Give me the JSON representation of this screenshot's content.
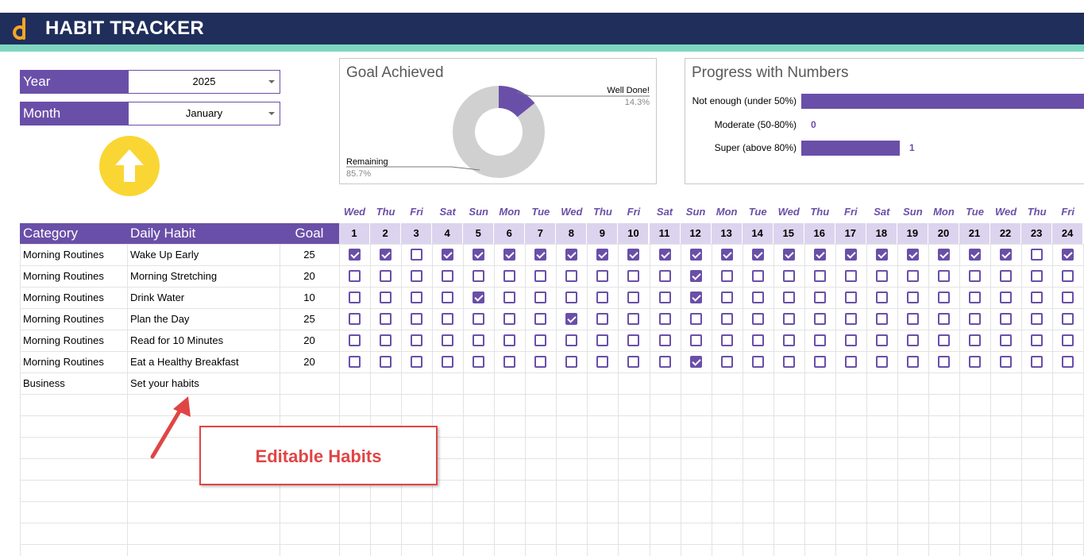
{
  "app": {
    "title": "HABIT TRACKER"
  },
  "selectors": {
    "year": {
      "label": "Year",
      "value": "2025"
    },
    "month": {
      "label": "Month",
      "value": "January"
    }
  },
  "goal_chart": {
    "title": "Goal Achieved",
    "slices": [
      {
        "name": "Well Done!",
        "percent_label": "14.3%",
        "value": 14.3,
        "color": "#6a4fa8"
      },
      {
        "name": "Remaining",
        "percent_label": "85.7%",
        "value": 85.7,
        "color": "#d0d0d0"
      }
    ]
  },
  "progress_chart": {
    "title": "Progress with Numbers",
    "rows": [
      {
        "label": "Not enough (under 50%)",
        "value": 5,
        "value_label": ""
      },
      {
        "label": "Moderate (50-80%)",
        "value": 0,
        "value_label": "0"
      },
      {
        "label": "Super (above 80%)",
        "value": 1,
        "value_label": "1"
      }
    ],
    "bar_color": "#6a4fa8"
  },
  "chart_data": [
    {
      "type": "pie",
      "title": "Goal Achieved",
      "categories": [
        "Well Done!",
        "Remaining"
      ],
      "values": [
        14.3,
        85.7
      ]
    },
    {
      "type": "bar",
      "title": "Progress with Numbers",
      "categories": [
        "Not enough (under 50%)",
        "Moderate (50-80%)",
        "Super (above 80%)"
      ],
      "values": [
        5,
        0,
        1
      ]
    }
  ],
  "table": {
    "headers": {
      "category": "Category",
      "habit": "Daily Habit",
      "goal": "Goal"
    },
    "days": [
      {
        "n": "1",
        "d": "Wed"
      },
      {
        "n": "2",
        "d": "Thu"
      },
      {
        "n": "3",
        "d": "Fri"
      },
      {
        "n": "4",
        "d": "Sat"
      },
      {
        "n": "5",
        "d": "Sun"
      },
      {
        "n": "6",
        "d": "Mon"
      },
      {
        "n": "7",
        "d": "Tue"
      },
      {
        "n": "8",
        "d": "Wed"
      },
      {
        "n": "9",
        "d": "Thu"
      },
      {
        "n": "10",
        "d": "Fri"
      },
      {
        "n": "11",
        "d": "Sat"
      },
      {
        "n": "12",
        "d": "Sun"
      },
      {
        "n": "13",
        "d": "Mon"
      },
      {
        "n": "14",
        "d": "Tue"
      },
      {
        "n": "15",
        "d": "Wed"
      },
      {
        "n": "16",
        "d": "Thu"
      },
      {
        "n": "17",
        "d": "Fri"
      },
      {
        "n": "18",
        "d": "Sat"
      },
      {
        "n": "19",
        "d": "Sun"
      },
      {
        "n": "20",
        "d": "Mon"
      },
      {
        "n": "21",
        "d": "Tue"
      },
      {
        "n": "22",
        "d": "Wed"
      },
      {
        "n": "23",
        "d": "Thu"
      },
      {
        "n": "24",
        "d": "Fri"
      }
    ],
    "rows": [
      {
        "category": "Morning Routines",
        "habit": "Wake Up Early",
        "goal": "25",
        "checks": [
          1,
          1,
          0,
          1,
          1,
          1,
          1,
          1,
          1,
          1,
          1,
          1,
          1,
          1,
          1,
          1,
          1,
          1,
          1,
          1,
          1,
          1,
          0,
          1
        ]
      },
      {
        "category": "Morning Routines",
        "habit": "Morning Stretching",
        "goal": "20",
        "checks": [
          0,
          0,
          0,
          0,
          0,
          0,
          0,
          0,
          0,
          0,
          0,
          1,
          0,
          0,
          0,
          0,
          0,
          0,
          0,
          0,
          0,
          0,
          0,
          0
        ]
      },
      {
        "category": "Morning Routines",
        "habit": "Drink Water",
        "goal": "10",
        "checks": [
          0,
          0,
          0,
          0,
          1,
          0,
          0,
          0,
          0,
          0,
          0,
          1,
          0,
          0,
          0,
          0,
          0,
          0,
          0,
          0,
          0,
          0,
          0,
          0
        ]
      },
      {
        "category": "Morning Routines",
        "habit": "Plan the Day",
        "goal": "25",
        "checks": [
          0,
          0,
          0,
          0,
          0,
          0,
          0,
          1,
          0,
          0,
          0,
          0,
          0,
          0,
          0,
          0,
          0,
          0,
          0,
          0,
          0,
          0,
          0,
          0
        ]
      },
      {
        "category": "Morning Routines",
        "habit": "Read for 10 Minutes",
        "goal": "20",
        "checks": [
          0,
          0,
          0,
          0,
          0,
          0,
          0,
          0,
          0,
          0,
          0,
          0,
          0,
          0,
          0,
          0,
          0,
          0,
          0,
          0,
          0,
          0,
          0,
          0
        ]
      },
      {
        "category": "Morning Routines",
        "habit": "Eat a Healthy Breakfast",
        "goal": "20",
        "checks": [
          0,
          0,
          0,
          0,
          0,
          0,
          0,
          0,
          0,
          0,
          0,
          1,
          0,
          0,
          0,
          0,
          0,
          0,
          0,
          0,
          0,
          0,
          0,
          0
        ]
      },
      {
        "category": "Business",
        "habit": "Set your habits",
        "goal": "",
        "checks": null
      }
    ]
  },
  "annotation": {
    "text": "Editable Habits"
  },
  "colors": {
    "header": "#202e5b",
    "accent": "#6a4fa8",
    "stripe": "#7fd6c0",
    "button": "#fad634",
    "callout": "#e04545"
  }
}
